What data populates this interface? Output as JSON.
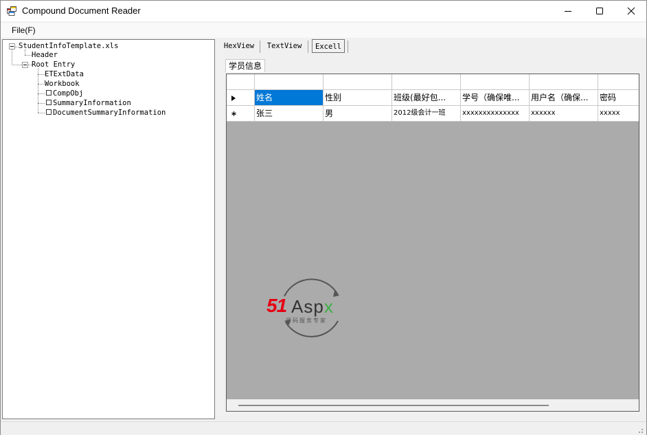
{
  "window": {
    "title": "Compound Document Reader"
  },
  "menu": {
    "file_label": "File(F)"
  },
  "tree": {
    "root": "StudentInfoTemplate.xls",
    "header": "Header",
    "root_entry": "Root Entry",
    "children": [
      "ETExtData",
      "Workbook",
      "CompObj",
      "SummaryInformation",
      "DocumentSummaryInformation"
    ]
  },
  "tabs": {
    "hex": "HexView",
    "text": "TextView",
    "excel": "Excell",
    "active": "Excell"
  },
  "sheet": {
    "tab_label": "学员信息",
    "rows": [
      [
        "姓名",
        "性别",
        "班级(最好包...",
        "学号（确保唯...",
        "用户名（确保...",
        "密码"
      ],
      [
        "张三",
        "男",
        "2012级会计一班",
        "xxxxxxxxxxxxxx",
        "xxxxxx",
        "xxxxx"
      ]
    ]
  },
  "watermark": {
    "brand_51": "51",
    "brand_aspx": "Aspx",
    "tagline": "源码服务专家"
  },
  "colors": {
    "selection": "#0078d7",
    "grid_background": "#ababab",
    "brand_red": "#e60012",
    "brand_green": "#3cb043"
  }
}
